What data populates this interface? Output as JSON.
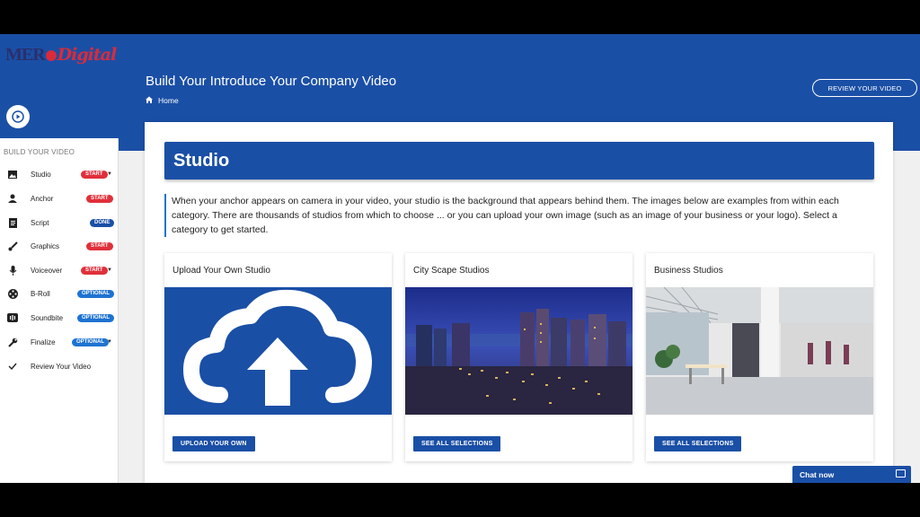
{
  "header": {
    "title": "Build Your Introduce Your Company Video",
    "breadcrumb": "Home",
    "review_button": "REVIEW YOUR VIDEO"
  },
  "brand": {
    "logo_part1": "MER",
    "logo_part2": "Digital"
  },
  "sidebar": {
    "section_title": "BUILD YOUR VIDEO",
    "items": [
      {
        "label": "Studio",
        "badge": "START",
        "icon": "image-icon"
      },
      {
        "label": "Anchor",
        "badge": "START",
        "icon": "person-icon"
      },
      {
        "label": "Script",
        "badge": "DONE",
        "icon": "script-icon"
      },
      {
        "label": "Graphics",
        "badge": "START",
        "icon": "brush-icon"
      },
      {
        "label": "Voiceover",
        "badge": "START",
        "icon": "microphone-icon"
      },
      {
        "label": "B-Roll",
        "badge": "OPTIONAL",
        "icon": "film-reel-icon"
      },
      {
        "label": "Soundbite",
        "badge": "OPTIONAL",
        "icon": "soundbite-icon"
      },
      {
        "label": "Finalize",
        "badge": "OPTIONAL",
        "icon": "wrench-icon"
      },
      {
        "label": "Review Your Video",
        "badge": "",
        "icon": "check-icon"
      }
    ]
  },
  "main": {
    "section_title": "Studio",
    "description": "When your anchor appears on camera in your video, your studio is the background that appears behind them. The images below are examples from within each category. There are thousands of studios from which to choose ... or you can upload your own image (such as an image of your business or your logo). Select a category to get started.",
    "cards": [
      {
        "title": "Upload Your Own Studio",
        "button": "UPLOAD YOUR OWN"
      },
      {
        "title": "City Scape Studios",
        "button": "SEE ALL SELECTIONS"
      },
      {
        "title": "Business Studios",
        "button": "SEE ALL SELECTIONS"
      }
    ]
  },
  "chat": {
    "label": "Chat now"
  },
  "colors": {
    "primary": "#1a4fa6",
    "badge_red": "#e0303a",
    "badge_optional": "#1e73d1"
  }
}
